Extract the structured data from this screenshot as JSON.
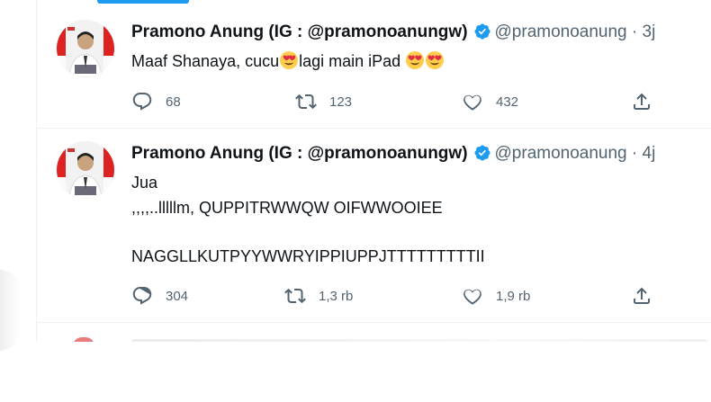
{
  "tweets": [
    {
      "author_name": "Pramono Anung (IG : @pramonoanungw)",
      "handle": "@pramonoanung",
      "time": "3j",
      "text_parts": [
        "Maaf Shanaya, cucu",
        "lagi main iPad"
      ],
      "emoji": "heart-eyes-emoji",
      "replies": "68",
      "retweets": "123",
      "likes": "432"
    },
    {
      "author_name": "Pramono Anung (IG : @pramonoanungw)",
      "handle": "@pramonoanung",
      "time": "4j",
      "lines": [
        "Jua",
        ",,,,..lllllm, QUPPITRWWQW OIFWWOOIEE",
        "NAGGLLKUTPYYWWRYIPPIUPPJTTTTTTTTTII"
      ],
      "replies": "304",
      "retweets": "1,3 rb",
      "likes": "1,9 rb"
    }
  ],
  "separator": "·",
  "colors": {
    "accent": "#1d9bf0",
    "text": "#0f1419",
    "muted": "#536471",
    "border": "#eff3f4"
  },
  "icons": [
    "verified-badge-icon",
    "reply-icon",
    "retweet-icon",
    "like-icon",
    "share-icon",
    "heart-eyes-emoji"
  ]
}
